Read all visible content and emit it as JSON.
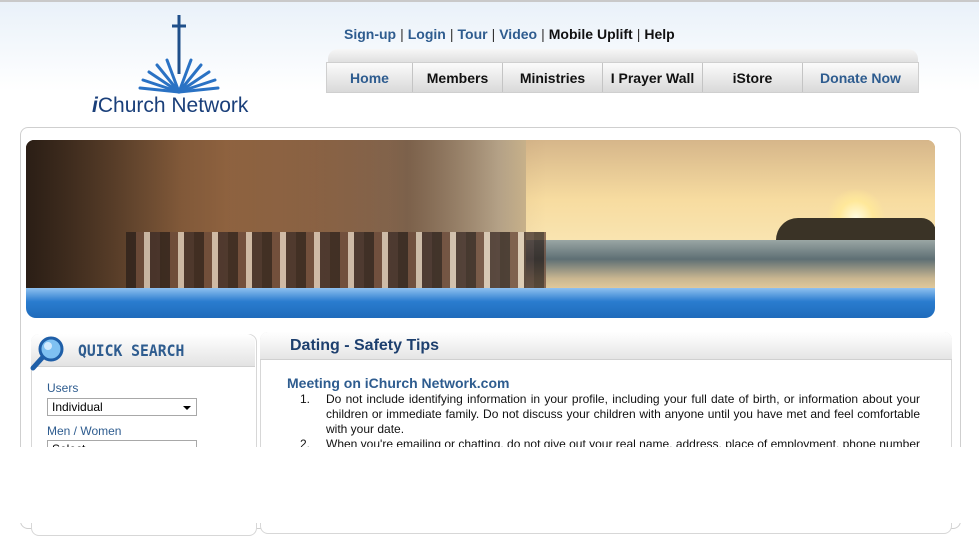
{
  "logo": {
    "prefix": "i",
    "name": "Church Network"
  },
  "toplinks": [
    {
      "label": "Sign-up",
      "style": "lnk"
    },
    {
      "label": "Login",
      "style": "lnk"
    },
    {
      "label": "Tour",
      "style": "lnk"
    },
    {
      "label": "Video",
      "style": "lnk"
    },
    {
      "label": "Mobile Uplift",
      "style": "blk"
    },
    {
      "label": "Help",
      "style": "blk"
    }
  ],
  "nav": {
    "tabs": [
      "Home",
      "Members",
      "Ministries",
      "I Prayer Wall",
      "iStore",
      "Donate Now"
    ]
  },
  "quick_search": {
    "title": "QUICK SEARCH",
    "users_label": "Users",
    "users_value": "Individual",
    "men_women_label": "Men / Women",
    "men_women_value": "Select"
  },
  "content": {
    "title": "Dating - Safety Tips",
    "section_title": "Meeting on iChurch Network.com",
    "tips": [
      {
        "num": "1.",
        "text": "Do not include identifying information in your profile, including your full date of birth, or information about your children or immediate family. Do not discuss your children with anyone until you have met and feel comfortable with your date."
      },
      {
        "num": "2.",
        "text": "When you're emailing or chatting, do not give out your real name, address, place of employment, phone number or any other information that could identify you."
      }
    ]
  },
  "colors": {
    "brand_blue": "#2e5c8f",
    "bar_blue": "#2a7ccf"
  }
}
